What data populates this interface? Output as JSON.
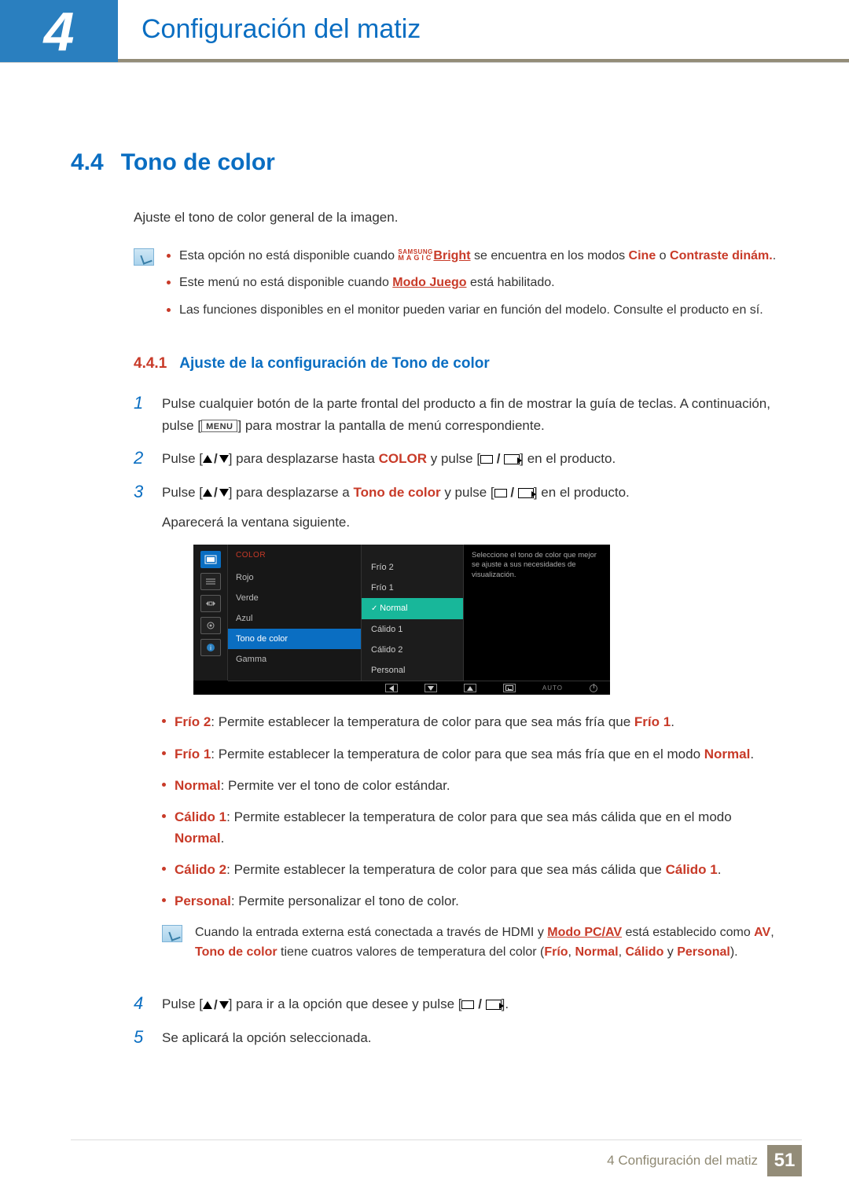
{
  "header": {
    "chapter_number": "4",
    "chapter_title": "Configuración del matiz"
  },
  "section": {
    "number": "4.4",
    "title": "Tono de color"
  },
  "intro": "Ajuste el tono de color general de la imagen.",
  "notes": {
    "n1_pre": "Esta opción no está disponible cuando ",
    "n1_magic_top": "SAMSUNG",
    "n1_magic_bot": "MAGIC",
    "n1_bright": "Bright",
    "n1_mid": " se encuentra en los modos ",
    "n1_cine": "Cine",
    "n1_o": " o ",
    "n1_contraste": "Contraste dinám.",
    "n1_dot": ".",
    "n2_pre": "Este menú no está disponible cuando ",
    "n2_modo": "Modo Juego",
    "n2_post": " está habilitado.",
    "n3": "Las funciones disponibles en el monitor pueden variar en función del modelo. Consulte el producto en sí."
  },
  "subsection": {
    "number": "4.4.1",
    "title": "Ajuste de la configuración de Tono de color"
  },
  "steps": {
    "s1a": "Pulse cualquier botón de la parte frontal del producto a fin de mostrar la guía de teclas. A continuación, pulse [",
    "s1_menu": "MENU",
    "s1b": "] para mostrar la pantalla de menú correspondiente.",
    "s2a": "Pulse [",
    "s2b": "] para desplazarse hasta ",
    "s2_color": "COLOR",
    "s2c": " y pulse [",
    "s2d": "] en el producto.",
    "s3a": "Pulse [",
    "s3b": "] para desplazarse a ",
    "s3_tono": "Tono de color",
    "s3c": " y pulse [",
    "s3d": "] en el producto.",
    "s3_after": "Aparecerá la ventana siguiente.",
    "s4a": "Pulse [",
    "s4b": "] para ir a la opción que desee y pulse [",
    "s4c": "].",
    "s5": "Se aplicará la opción seleccionada."
  },
  "osd": {
    "title": "COLOR",
    "menu": [
      "Rojo",
      "Verde",
      "Azul",
      "Tono de color",
      "Gamma"
    ],
    "menu_hl_index": 3,
    "sub": [
      "Frío 2",
      "Frío 1",
      "Normal",
      "Cálido 1",
      "Cálido 2",
      "Personal"
    ],
    "sub_hl_index": 2,
    "help": "Seleccione el tono de color que mejor se ajuste a sus necesidades de visualización.",
    "auto": "AUTO"
  },
  "descs": {
    "d1_label": "Frío 2",
    "d1_txt": ": Permite establecer la temperatura de color para que sea más fría que ",
    "d1_ref": "Frío 1",
    "d2_label": "Frío 1",
    "d2_txt": ": Permite establecer la temperatura de color para que sea más fría que en el modo ",
    "d2_ref": "Normal",
    "d3_label": "Normal",
    "d3_txt": ": Permite ver el tono de color estándar.",
    "d4_label": "Cálido 1",
    "d4_txt": ": Permite establecer la temperatura de color para que sea más cálida que en el modo ",
    "d4_ref": "Normal",
    "d5_label": "Cálido 2",
    "d5_txt": ": Permite establecer la temperatura de color para que sea más cálida que ",
    "d5_ref": "Cálido 1",
    "d6_label": "Personal",
    "d6_txt": ": Permite personalizar el tono de color."
  },
  "note2": {
    "pre": "Cuando la entrada externa está conectada a través de HDMI y ",
    "modo": "Modo PC/AV",
    "mid1": " está establecido como ",
    "av": "AV",
    "mid2": ", ",
    "tono": "Tono de color",
    "mid3": " tiene cuatros valores de temperatura del color (",
    "frio": "Frío",
    "c1": ", ",
    "normal": "Normal",
    "c2": ", ",
    "calido": "Cálido",
    "c3": " y ",
    "personal": "Personal",
    "end": ")."
  },
  "footer": {
    "label": "4 Configuración del matiz",
    "page": "51"
  }
}
